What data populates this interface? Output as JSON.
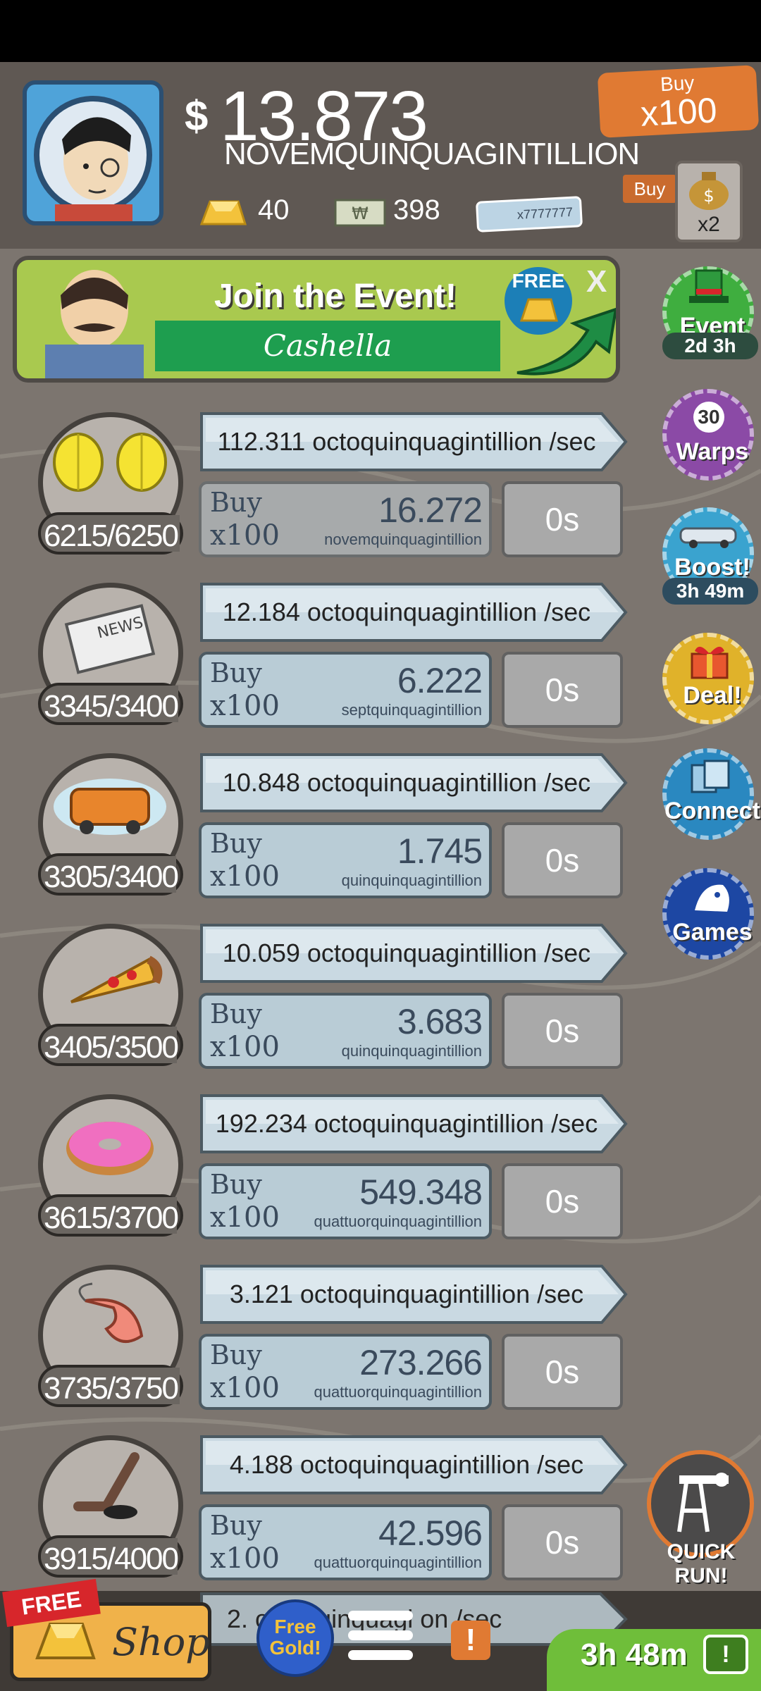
{
  "header": {
    "cash_symbol": "$",
    "cash_amount": "13.873",
    "cash_unit": "NOVEMQUINQUAGINTILLION",
    "gold": "40",
    "megabucks": "398",
    "ticket_label": "x7777777",
    "buy_tag_label": "Buy",
    "buy_tag_qty": "x100",
    "buy_small_label": "Buy",
    "bag_multiplier": "x2"
  },
  "event_banner": {
    "title": "Join the Event!",
    "name": "Cashella",
    "free_label": "FREE",
    "close_label": "X"
  },
  "rail": [
    {
      "label": "Event",
      "sub": "2d 3h",
      "color": "#3fae3f",
      "icon": "top-hat-icon"
    },
    {
      "label": "Warps",
      "badge": "30",
      "color": "#8b4aa6",
      "icon": "clock-icon"
    },
    {
      "label": "Boost!",
      "sub": "3h 49m",
      "color": "#3aa3cf",
      "icon": "car-icon"
    },
    {
      "label": "Deal!",
      "color": "#e0b22a",
      "icon": "gift-icon"
    },
    {
      "label": "Connect",
      "color": "#2a88c0",
      "icon": "cards-icon"
    },
    {
      "label": "Games",
      "color": "#1d47a3",
      "icon": "mascot-icon"
    }
  ],
  "businesses": [
    {
      "icon": "lemon-icon",
      "owned": "6215/6250",
      "progress": 0.994,
      "rate": "112.311 octoquinquagintillion /sec",
      "buy": "Buy",
      "qty": "x100",
      "cost": "16.272",
      "cost_unit": "novemquinquagintillion",
      "affordable": false,
      "timer": "0s"
    },
    {
      "icon": "newspaper-icon",
      "owned": "3345/3400",
      "progress": 0.984,
      "rate": "12.184 octoquinquagintillion /sec",
      "buy": "Buy",
      "qty": "x100",
      "cost": "6.222",
      "cost_unit": "septquinquagintillion",
      "affordable": true,
      "timer": "0s"
    },
    {
      "icon": "car-wash-icon",
      "owned": "3305/3400",
      "progress": 0.972,
      "rate": "10.848 octoquinquagintillion /sec",
      "buy": "Buy",
      "qty": "x100",
      "cost": "1.745",
      "cost_unit": "quinquinquagintillion",
      "affordable": true,
      "timer": "0s"
    },
    {
      "icon": "pizza-icon",
      "owned": "3405/3500",
      "progress": 0.973,
      "rate": "10.059 octoquinquagintillion /sec",
      "buy": "Buy",
      "qty": "x100",
      "cost": "3.683",
      "cost_unit": "quinquinquagintillion",
      "affordable": true,
      "timer": "0s"
    },
    {
      "icon": "donut-icon",
      "owned": "3615/3700",
      "progress": 0.977,
      "rate": "192.234 octoquinquagintillion /sec",
      "buy": "Buy",
      "qty": "x100",
      "cost": "549.348",
      "cost_unit": "quattuorquinquagintillion",
      "affordable": true,
      "timer": "0s"
    },
    {
      "icon": "shrimp-icon",
      "owned": "3735/3750",
      "progress": 0.996,
      "rate": "3.121 octoquinquagintillion /sec",
      "buy": "Buy",
      "qty": "x100",
      "cost": "273.266",
      "cost_unit": "quattuorquinquagintillion",
      "affordable": true,
      "timer": "0s"
    },
    {
      "icon": "hockey-stick-icon",
      "owned": "3915/4000",
      "progress": 0.979,
      "rate": "4.188 octoquinquagintillion /sec",
      "buy": "Buy",
      "qty": "x100",
      "cost": "42.596",
      "cost_unit": "quattuorquinquagintillion",
      "affordable": true,
      "timer": "0s"
    }
  ],
  "bottom": {
    "free_ribbon": "FREE",
    "shop_label": "Shop",
    "free_gold_label": "Free Gold!",
    "quick_run_label": "QUICK RUN!",
    "peek_rate": "2. octoquinquagi on /sec",
    "tv_timer": "3h 48m",
    "alert_glyph": "!",
    "tv_glyph": "!"
  },
  "colors": {
    "background": "#7c756f",
    "header": "#5f5853",
    "rate_ribbon": "#c9d9e2",
    "buy_box": "#b9ccd6",
    "accent_orange": "#e07a33"
  }
}
